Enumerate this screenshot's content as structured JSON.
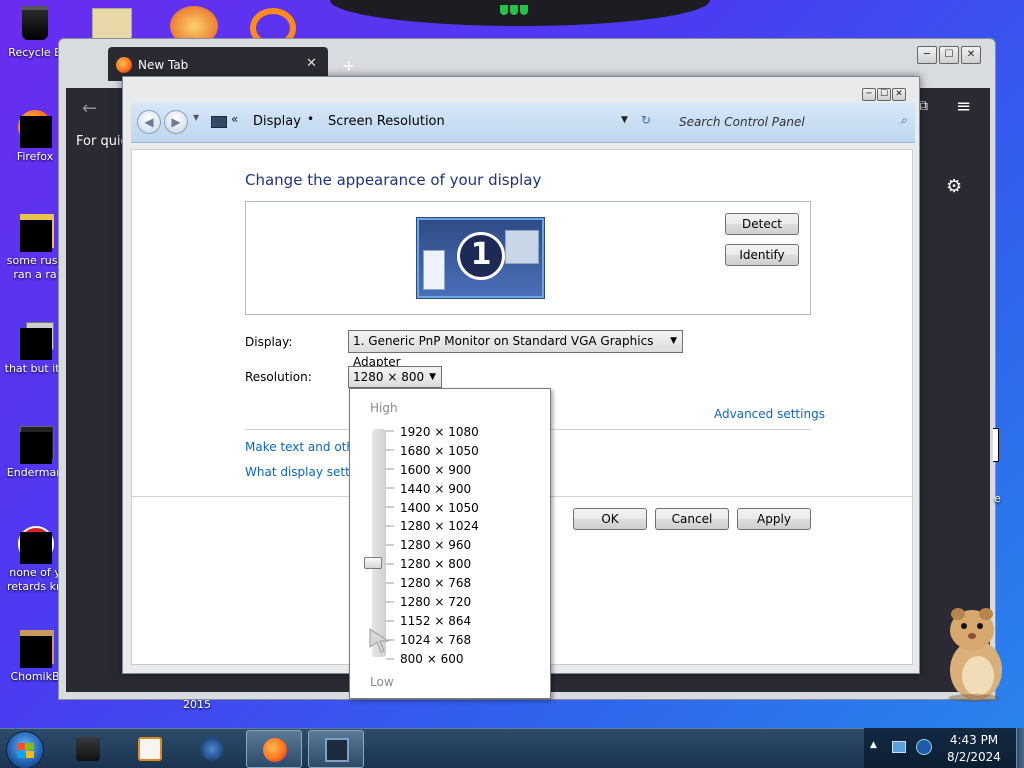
{
  "desktop": {
    "icons": [
      {
        "label": "Recycle B"
      },
      {
        "label": "Firefox"
      },
      {
        "label": "some russ ran a ra"
      },
      {
        "label": "that but its"
      },
      {
        "label": "Enderman"
      },
      {
        "label": "none of y retards kn"
      },
      {
        "label": "ChomikB"
      }
    ],
    "year_text": "2015",
    "right_edge_text": "e"
  },
  "firefox": {
    "tab_title": "New Tab",
    "tab_close": "✕",
    "new_tab": "+",
    "quick_text": "For quick",
    "back_arrow": "←",
    "menu_icon": "≡",
    "settings_icon": "⚙",
    "window_buttons": [
      "─",
      "☐",
      "✕"
    ]
  },
  "control_panel": {
    "window_buttons": [
      "─",
      "☐",
      "✕"
    ],
    "address": {
      "back": "◀",
      "forward": "▶",
      "crumbs_chevron": "«",
      "crumb1": "Display",
      "separator": "•",
      "crumb2": "Screen Resolution",
      "dropdown": "▼",
      "refresh": "↻",
      "search_placeholder": "Search Control Panel",
      "search_icon": "⌕"
    },
    "heading": "Change the appearance of your display",
    "monitor_number": "1",
    "detect_label": "Detect",
    "identify_label": "Identify",
    "display_label": "Display:",
    "display_value": "1. Generic PnP Monitor on Standard VGA Graphics Adapter",
    "resolution_label": "Resolution:",
    "resolution_value": "1280 × 800",
    "advanced_link": "Advanced settings",
    "text_link": "Make text and other",
    "what_link": "What display setting",
    "ok_label": "OK",
    "cancel_label": "Cancel",
    "apply_label": "Apply",
    "dropdown_arrow": "▼"
  },
  "resolution_dropdown": {
    "high_label": "High",
    "low_label": "Low",
    "options": [
      "1920 × 1080",
      "1680 × 1050",
      "1600 × 900",
      "1440 × 900",
      "1400 × 1050",
      "1280 × 1024",
      "1280 × 960",
      "1280 × 800",
      "1280 × 768",
      "1280 × 720",
      "1152 × 864",
      "1024 × 768",
      "800 × 600"
    ],
    "selected": "1280 × 800"
  },
  "taskbar": {
    "time": "4:43 PM",
    "date": "8/2/2024",
    "tray_up": "▲"
  }
}
